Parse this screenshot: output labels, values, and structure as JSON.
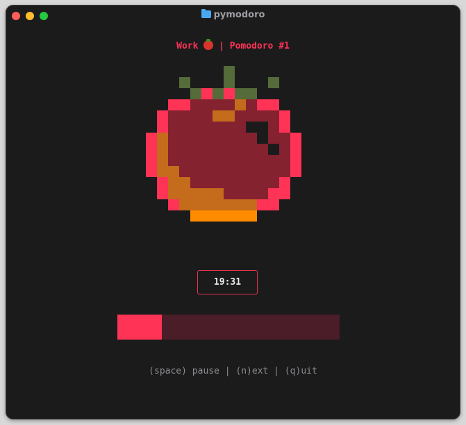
{
  "window": {
    "title": "pymodoro",
    "title_icon": "folder-icon"
  },
  "header": {
    "mode": "Work",
    "mode_icon": "tomato-emoji",
    "separator": "|",
    "session": "Pomodoro #1"
  },
  "timer": {
    "remaining": "19:31"
  },
  "progress": {
    "fraction": 0.2
  },
  "help": {
    "text": "(space) pause | (n)ext | (q)uit"
  },
  "colors": {
    "accent": "#ff3355",
    "progress_track": "#4a1d28",
    "tomato_body": "#85222f",
    "tomato_edge": "#ff3355",
    "tomato_shade": "#c46b1c",
    "tomato_base": "#ff8c00",
    "stem": "#556b3a",
    "highlight_gap": "#1b1b1c"
  }
}
